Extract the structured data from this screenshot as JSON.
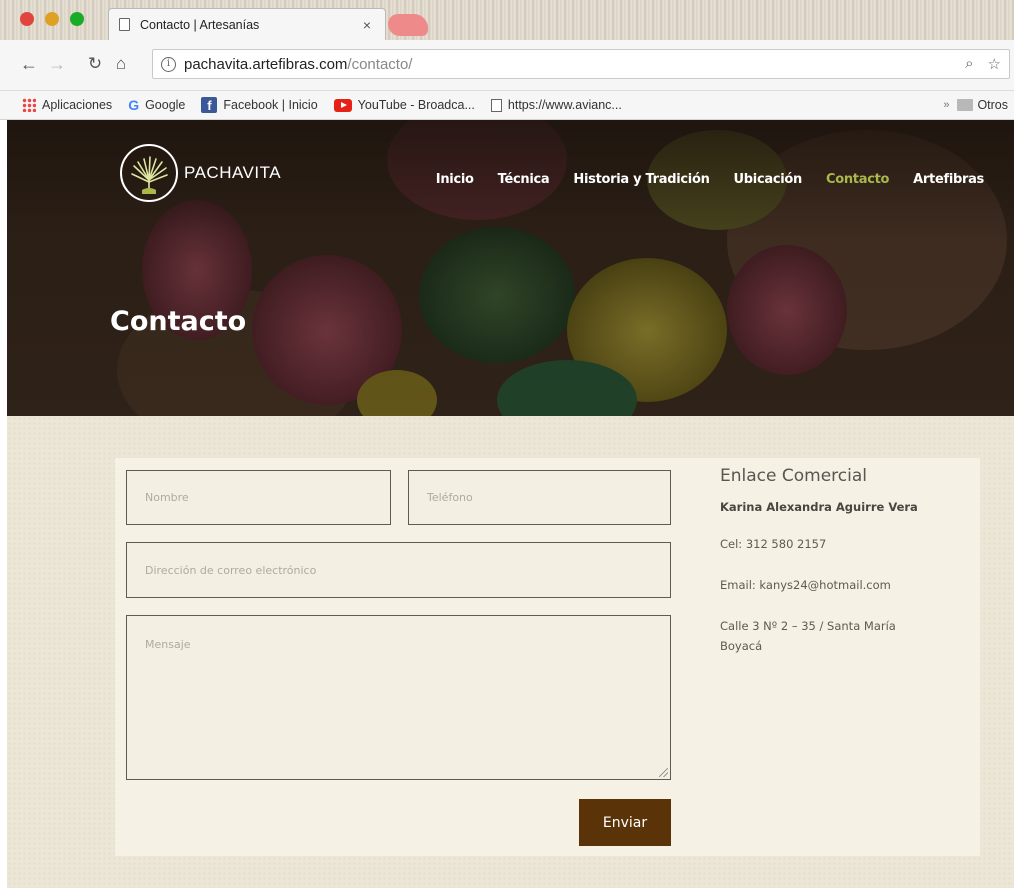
{
  "browser": {
    "tab_title": "Contacto | Artesanías",
    "tab_close": "×",
    "url_host": "pachavita.artefibras.com",
    "url_path": "/contacto/",
    "bookmarks": [
      {
        "label": "Aplicaciones",
        "icon": "apps-icon"
      },
      {
        "label": "Google",
        "icon": "google-icon"
      },
      {
        "label": "Facebook | Inicio",
        "icon": "facebook-icon"
      },
      {
        "label": "YouTube - Broadca...",
        "icon": "youtube-icon"
      },
      {
        "label": "https://www.avianc...",
        "icon": "page-icon"
      }
    ],
    "bookmarks_more": "»",
    "other_bookmarks": "Otros"
  },
  "site": {
    "brand": "PACHAVITA",
    "nav": [
      {
        "label": "Inicio"
      },
      {
        "label": "Técnica"
      },
      {
        "label": "Historia y Tradición"
      },
      {
        "label": "Ubicación"
      },
      {
        "label": "Contacto",
        "active": true
      },
      {
        "label": "Artefibras"
      }
    ],
    "hero_title": "Contacto",
    "accent_color": "#a8b84a",
    "button_color": "#5a3408"
  },
  "form": {
    "name_placeholder": "Nombre",
    "phone_placeholder": "Teléfono",
    "email_placeholder": "Dirección de correo electrónico",
    "message_placeholder": "Mensaje",
    "submit_label": "Enviar"
  },
  "contact_info": {
    "title": "Enlace Comercial",
    "name": "Karina Alexandra Aguirre Vera",
    "phone": "Cel: 312 580 2157",
    "email": "Email: kanys24@hotmail.com",
    "address_line1": "Calle 3 Nº 2 – 35  / Santa María",
    "address_line2": "Boyacá"
  }
}
